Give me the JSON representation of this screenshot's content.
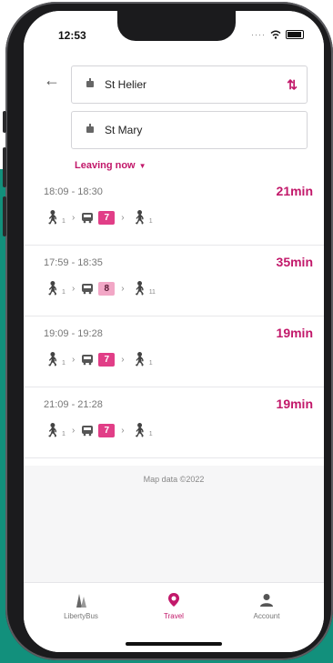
{
  "status_bar": {
    "time": "12:53"
  },
  "search": {
    "origin": "St Helier",
    "destination": "St Mary",
    "leaving_label": "Leaving now"
  },
  "results": [
    {
      "time_range": "18:09 - 18:30",
      "duration": "21min",
      "walk_before": "1",
      "route": "7",
      "walk_after": "1",
      "route_style": "normal"
    },
    {
      "time_range": "17:59 - 18:35",
      "duration": "35min",
      "walk_before": "1",
      "route": "8",
      "walk_after": "11",
      "route_style": "light"
    },
    {
      "time_range": "19:09 - 19:28",
      "duration": "19min",
      "walk_before": "1",
      "route": "7",
      "walk_after": "1",
      "route_style": "normal"
    },
    {
      "time_range": "21:09 - 21:28",
      "duration": "19min",
      "walk_before": "1",
      "route": "7",
      "walk_after": "1",
      "route_style": "normal"
    }
  ],
  "map_credit": "Map data ©2022",
  "tabs": [
    {
      "label": "LibertyBus",
      "icon": "libertybus-logo-icon",
      "active": false
    },
    {
      "label": "Travel",
      "icon": "location-pin-icon",
      "active": true
    },
    {
      "label": "Account",
      "icon": "person-icon",
      "active": false
    }
  ],
  "colors": {
    "accent": "#c2186a",
    "badge": "#e13e87",
    "background": "#12907c"
  }
}
